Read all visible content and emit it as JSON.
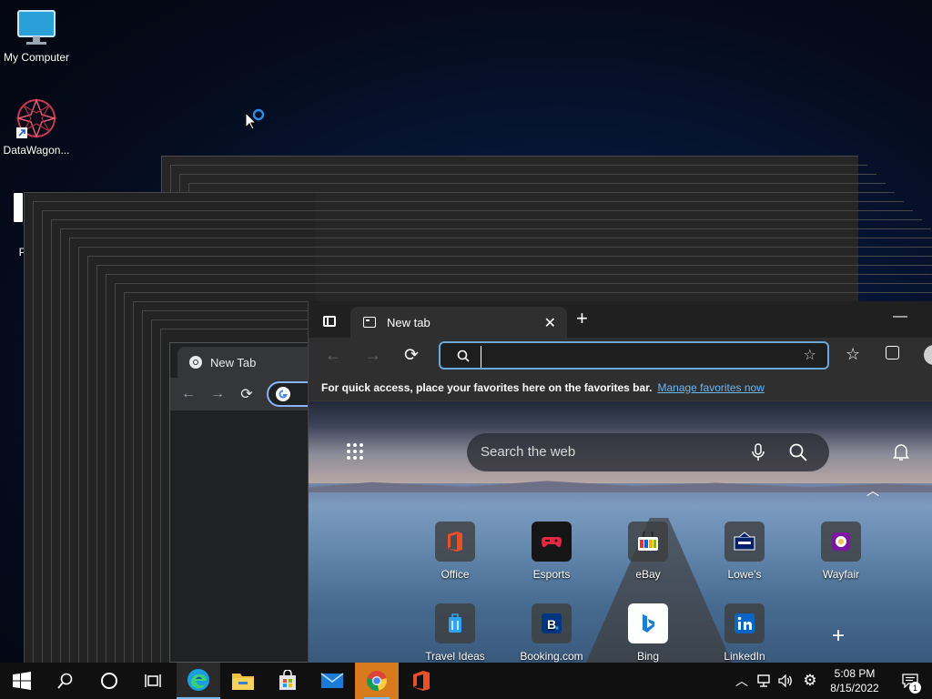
{
  "desktop": {
    "icons": [
      {
        "label": "My Computer"
      },
      {
        "label": "DataWagon..."
      },
      {
        "label": "Pen"
      }
    ]
  },
  "chrome": {
    "tab_title": "New Tab"
  },
  "edge": {
    "tab_title": "New tab",
    "address_value": "",
    "favorites_prompt": "For quick access, place your favorites here on the favorites bar.",
    "favorites_link": "Manage favorites now",
    "search_placeholder": "Search the web",
    "quick_links": [
      {
        "label": "Office",
        "icon": "office-icon"
      },
      {
        "label": "Esports",
        "icon": "esports-icon"
      },
      {
        "label": "eBay",
        "icon": "ebay-icon"
      },
      {
        "label": "Lowe's",
        "icon": "lowes-icon"
      },
      {
        "label": "Wayfair",
        "icon": "wayfair-icon"
      },
      {
        "label": "Travel Ideas",
        "icon": "travel-icon"
      },
      {
        "label": "Booking.com",
        "icon": "booking-icon"
      },
      {
        "label": "Bing",
        "icon": "bing-icon"
      },
      {
        "label": "LinkedIn",
        "icon": "linkedin-icon"
      }
    ]
  },
  "taskbar": {
    "time": "5:08 PM",
    "date": "8/15/2022",
    "notification_count": "1",
    "accent": "#76b9ed"
  }
}
